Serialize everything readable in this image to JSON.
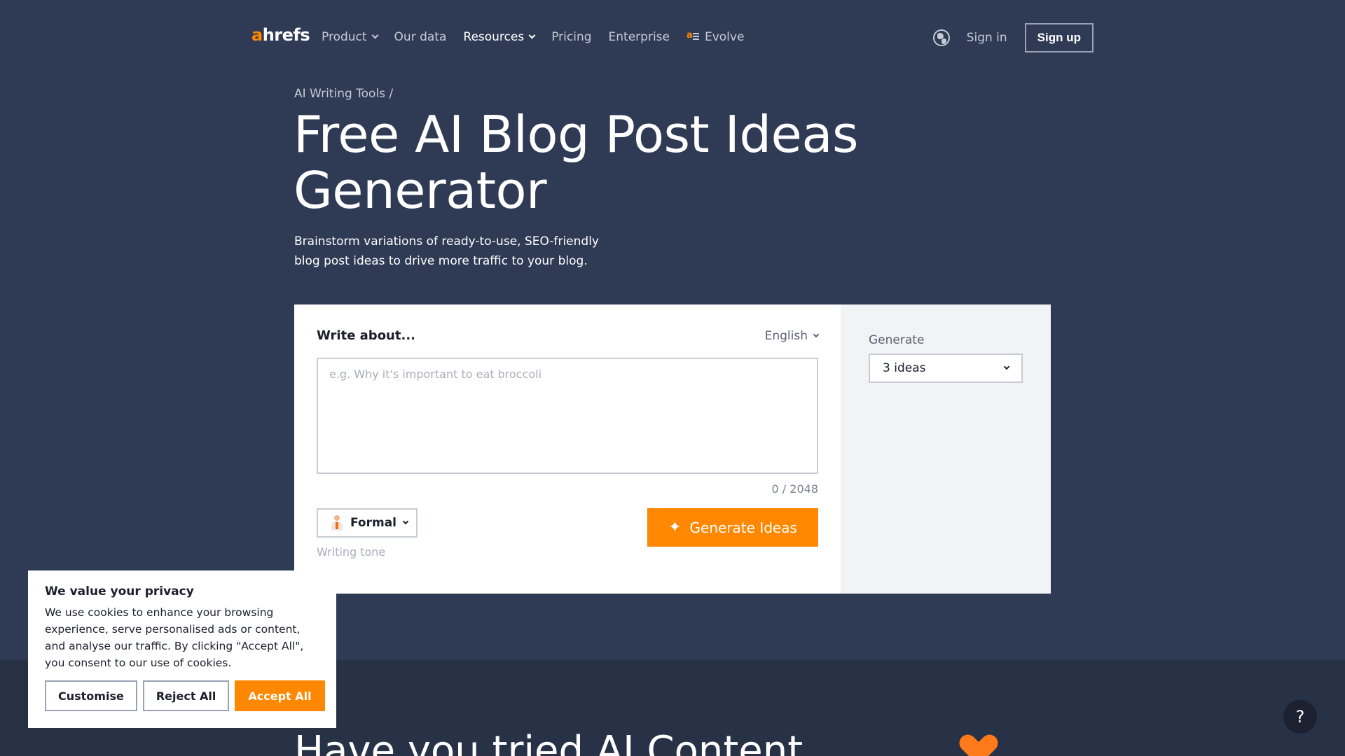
{
  "nav": {
    "logo_a": "a",
    "logo_rest": "hrefs",
    "links": [
      {
        "label": "Product",
        "has_dropdown": true
      },
      {
        "label": "Our data",
        "has_dropdown": false
      },
      {
        "label": "Resources",
        "has_dropdown": true
      },
      {
        "label": "Pricing",
        "has_dropdown": false
      },
      {
        "label": "Enterprise",
        "has_dropdown": false
      },
      {
        "label": "Evolve",
        "has_dropdown": false
      }
    ],
    "sign_in": "Sign in",
    "sign_up": "Sign up"
  },
  "hero": {
    "breadcrumb": "AI Writing Tools /",
    "title": "Free AI Blog Post Ideas Generator",
    "subtitle": "Brainstorm variations of ready-to-use, SEO-friendly blog post ideas to drive more traffic to your blog."
  },
  "tool": {
    "write_label": "Write about...",
    "language": "English",
    "textarea_placeholder": "e.g. Why it's important to eat broccoli",
    "textarea_value": "",
    "counter": "0 / 2048",
    "tone_value": "Formal",
    "tone_label": "Writing tone",
    "generate_button": "Generate Ideas",
    "generate_label": "Generate",
    "generate_select": "3 ideas"
  },
  "lower": {
    "title": "Have you tried AI Content"
  },
  "cookie": {
    "title": "We value your privacy",
    "text": "We use cookies to enhance your browsing experience, serve personalised ads or content, and analyse our traffic. By clicking \"Accept All\", you consent to our use of cookies.",
    "customise": "Customise",
    "reject": "Reject All",
    "accept": "Accept All"
  },
  "help": "?",
  "colors": {
    "background": "#2f3b55",
    "accent": "#ff8800",
    "card": "#ffffff",
    "card_side": "#f2f3f5"
  },
  "icons": [
    "chevron-down-icon",
    "evolve-icon",
    "globe-icon",
    "writing-tone-icon",
    "sparkle-icon",
    "heart-icon",
    "help-icon"
  ]
}
